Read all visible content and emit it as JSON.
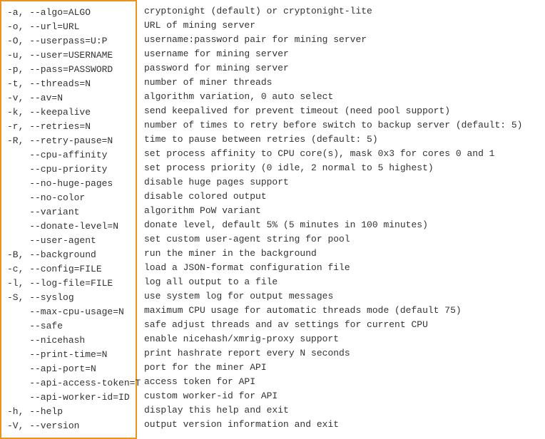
{
  "options": [
    {
      "flag": "-a, --algo=ALGO",
      "desc": "cryptonight (default) or cryptonight-lite"
    },
    {
      "flag": "-o, --url=URL",
      "desc": "URL of mining server"
    },
    {
      "flag": "-O, --userpass=U:P",
      "desc": "username:password pair for mining server"
    },
    {
      "flag": "-u, --user=USERNAME",
      "desc": "username for mining server"
    },
    {
      "flag": "-p, --pass=PASSWORD",
      "desc": "password for mining server"
    },
    {
      "flag": "-t, --threads=N",
      "desc": "number of miner threads"
    },
    {
      "flag": "-v, --av=N",
      "desc": "algorithm variation, 0 auto select"
    },
    {
      "flag": "-k, --keepalive",
      "desc": "send keepalived for prevent timeout (need pool support)"
    },
    {
      "flag": "-r, --retries=N",
      "desc": "number of times to retry before switch to backup server (default: 5)"
    },
    {
      "flag": "-R, --retry-pause=N",
      "desc": "time to pause between retries (default: 5)"
    },
    {
      "flag": "    --cpu-affinity",
      "desc": "set process affinity to CPU core(s), mask 0x3 for cores 0 and 1"
    },
    {
      "flag": "    --cpu-priority",
      "desc": "set process priority (0 idle, 2 normal to 5 highest)"
    },
    {
      "flag": "    --no-huge-pages",
      "desc": "disable huge pages support"
    },
    {
      "flag": "    --no-color",
      "desc": "disable colored output"
    },
    {
      "flag": "    --variant",
      "desc": "algorithm PoW variant"
    },
    {
      "flag": "    --donate-level=N",
      "desc": "donate level, default 5% (5 minutes in 100 minutes)"
    },
    {
      "flag": "    --user-agent",
      "desc": "set custom user-agent string for pool"
    },
    {
      "flag": "-B, --background",
      "desc": "run the miner in the background"
    },
    {
      "flag": "-c, --config=FILE",
      "desc": "load a JSON-format configuration file"
    },
    {
      "flag": "-l, --log-file=FILE",
      "desc": "log all output to a file"
    },
    {
      "flag": "-S, --syslog",
      "desc": "use system log for output messages"
    },
    {
      "flag": "    --max-cpu-usage=N",
      "desc": "maximum CPU usage for automatic threads mode (default 75)"
    },
    {
      "flag": "    --safe",
      "desc": "safe adjust threads and av settings for current CPU"
    },
    {
      "flag": "    --nicehash",
      "desc": "enable nicehash/xmrig-proxy support"
    },
    {
      "flag": "    --print-time=N",
      "desc": "print hashrate report every N seconds"
    },
    {
      "flag": "    --api-port=N",
      "desc": "port for the miner API"
    },
    {
      "flag": "    --api-access-token=T",
      "desc": "access token for API"
    },
    {
      "flag": "    --api-worker-id=ID",
      "desc": "custom worker-id for API"
    },
    {
      "flag": "-h, --help",
      "desc": "display this help and exit"
    },
    {
      "flag": "-V, --version",
      "desc": "output version information and exit"
    }
  ]
}
